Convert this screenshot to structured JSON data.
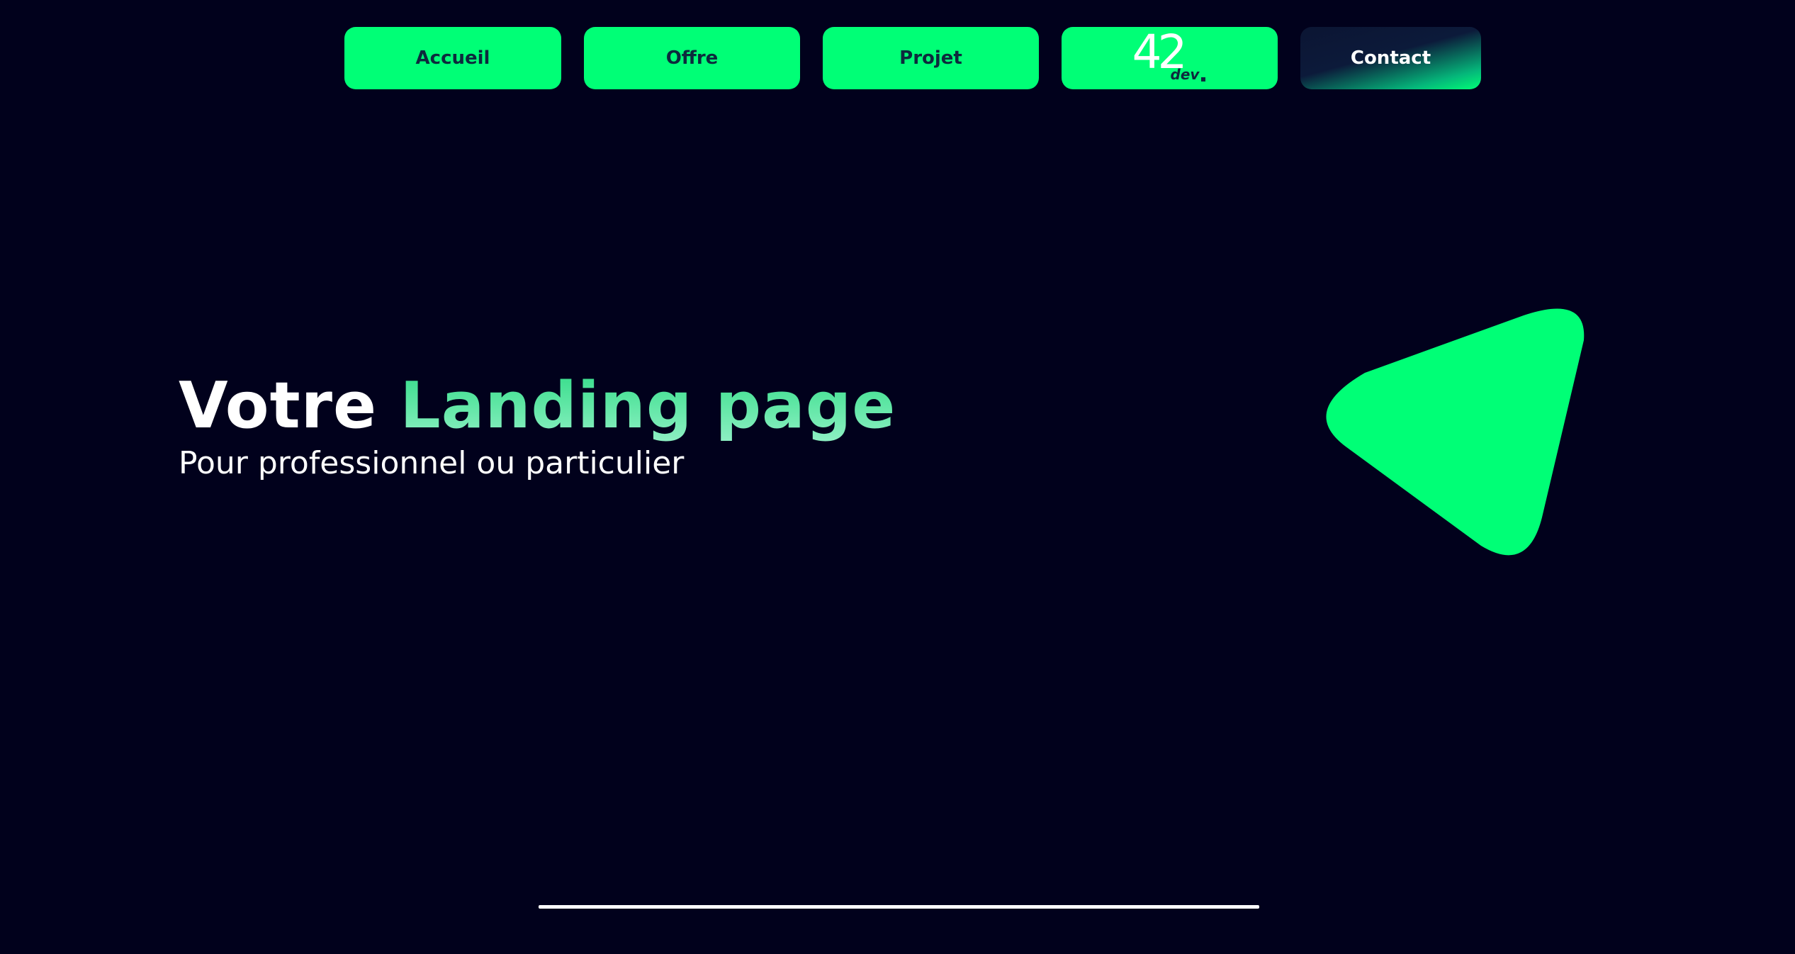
{
  "nav": {
    "accueil": "Accueil",
    "offre": "Offre",
    "projet": "Projet",
    "logo": {
      "number": "42",
      "suffix": "dev"
    },
    "contact": "Contact"
  },
  "hero": {
    "title_white": "Votre",
    "title_green": "Landing page",
    "subtitle": "Pour professionnel ou particulier"
  },
  "colors": {
    "background": "#01011c",
    "accent": "#00ff76",
    "button_text": "#0d2a3d",
    "title_gradient_start": "#33dd88",
    "title_gradient_end": "#8ff0c4"
  },
  "decor": {
    "shape_icon": "rounded-triangle-icon"
  }
}
